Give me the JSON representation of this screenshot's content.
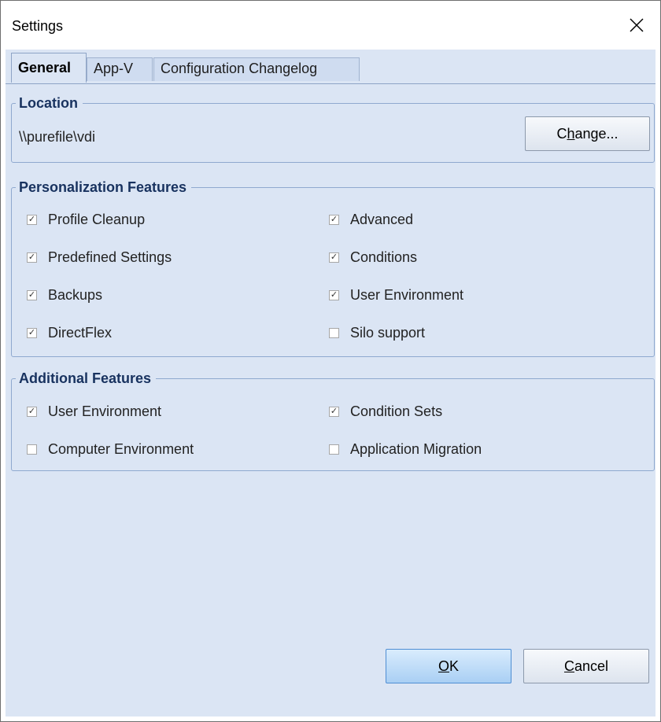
{
  "window": {
    "title": "Settings"
  },
  "tabs": [
    {
      "label": "General",
      "active": true
    },
    {
      "label": "App-V",
      "active": false
    },
    {
      "label": "Configuration Changelog",
      "active": false
    }
  ],
  "location": {
    "legend": "Location",
    "path": "\\\\purefile\\vdi",
    "change_label_pre": "C",
    "change_label_access": "h",
    "change_label_post": "ange..."
  },
  "personalization": {
    "legend": "Personalization Features",
    "items": [
      {
        "label": "Profile Cleanup",
        "checked": true
      },
      {
        "label": "Advanced",
        "checked": true
      },
      {
        "label": "Predefined Settings",
        "checked": true
      },
      {
        "label": "Conditions",
        "checked": true
      },
      {
        "label": "Backups",
        "checked": true
      },
      {
        "label": "User Environment",
        "checked": true
      },
      {
        "label": "DirectFlex",
        "checked": true
      },
      {
        "label": "Silo support",
        "checked": false
      }
    ]
  },
  "additional": {
    "legend": "Additional Features",
    "items": [
      {
        "label": "User Environment",
        "checked": true
      },
      {
        "label": "Condition Sets",
        "checked": true
      },
      {
        "label": "Computer Environment",
        "checked": false
      },
      {
        "label": "Application Migration",
        "checked": false
      }
    ]
  },
  "buttons": {
    "ok_access": "O",
    "ok_rest": "K",
    "cancel_access": "C",
    "cancel_rest": "ancel"
  },
  "check_glyph": "✓",
  "colors": {
    "accent": "#18325f",
    "panel": "#dbe5f4",
    "primary_button": "#a9cff4"
  }
}
